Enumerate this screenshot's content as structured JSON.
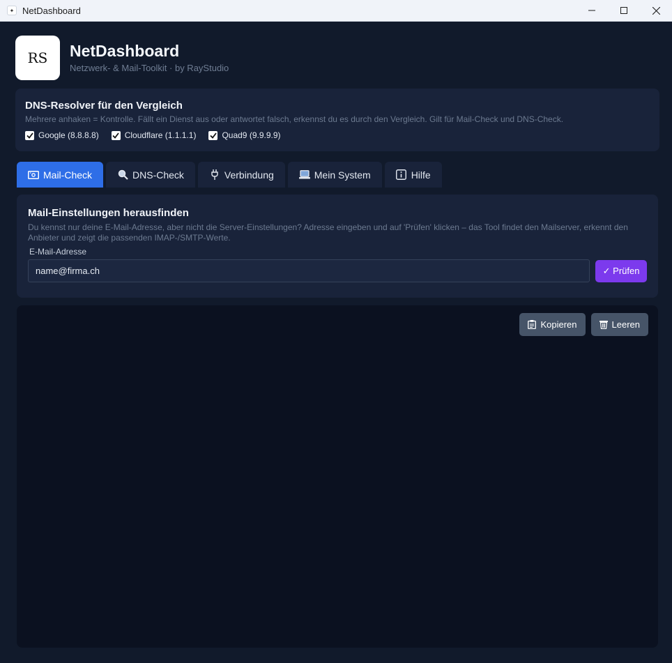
{
  "window": {
    "title": "NetDashboard"
  },
  "header": {
    "logo_text": "RS",
    "title": "NetDashboard",
    "subtitle": "Netzwerk- & Mail-Toolkit · by RayStudio"
  },
  "resolver": {
    "title": "DNS-Resolver für den Vergleich",
    "description": "Mehrere anhaken = Kontrolle. Fällt ein Dienst aus oder antwortet falsch, erkennst du es durch den Vergleich. Gilt für Mail-Check und DNS-Check.",
    "options": [
      {
        "label": "Google (8.8.8.8)",
        "checked": true
      },
      {
        "label": "Cloudflare (1.1.1.1)",
        "checked": true
      },
      {
        "label": "Quad9 (9.9.9.9)",
        "checked": true
      }
    ]
  },
  "tabs": [
    {
      "label": "Mail-Check",
      "icon": "mail-icon",
      "active": true
    },
    {
      "label": "DNS-Check",
      "icon": "magnifier-icon",
      "active": false
    },
    {
      "label": "Verbindung",
      "icon": "plug-icon",
      "active": false
    },
    {
      "label": "Mein System",
      "icon": "laptop-icon",
      "active": false
    },
    {
      "label": "Hilfe",
      "icon": "info-icon",
      "active": false
    }
  ],
  "mail": {
    "title": "Mail-Einstellungen herausfinden",
    "description": "Du kennst nur deine E-Mail-Adresse, aber nicht die Server-Einstellungen? Adresse eingeben und auf 'Prüfen' klicken – das Tool findet den Mailserver, erkennt den Anbieter und zeigt die passenden IMAP-/SMTP-Werte.",
    "field_label": "E-Mail-Adresse",
    "email_value": "name@firma.ch",
    "check_label": "✓ Prüfen"
  },
  "output": {
    "copy_label": "Kopieren",
    "clear_label": "Leeren"
  },
  "colors": {
    "background": "#111a2b",
    "card": "#19233a",
    "output_bg": "#0b1120",
    "tab_active": "#2e6ee7",
    "primary_button": "#7c3aed",
    "secondary_button": "#465468"
  }
}
